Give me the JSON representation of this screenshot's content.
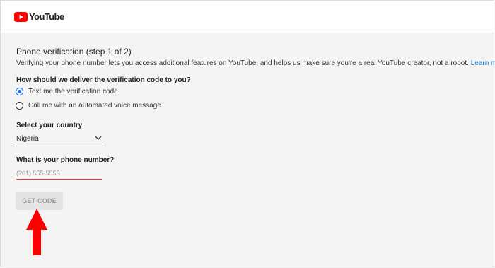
{
  "header": {
    "logo_text": "YouTube"
  },
  "verification": {
    "title": "Phone verification (step 1 of 2)",
    "description": "Verifying your phone number lets you access additional features on YouTube, and helps us make sure you're a real YouTube creator, not a robot.",
    "learn_more": "Learn more",
    "delivery_question": "How should we deliver the verification code to you?",
    "options": [
      {
        "label": "Text me the verification code",
        "selected": true
      },
      {
        "label": "Call me with an automated voice message",
        "selected": false
      }
    ],
    "country_label": "Select your country",
    "country_value": "Nigeria",
    "phone_label": "What is your phone number?",
    "phone_placeholder": "(201) 555-5555",
    "phone_value": "",
    "get_code_label": "GET CODE"
  },
  "colors": {
    "brand_red": "#ff0000",
    "accent_blue": "#1a73e8",
    "link_blue": "#1a73c8",
    "input_error_red": "#e53935",
    "annotation_red": "#ff0000"
  },
  "icons": {
    "logo": "youtube-play-icon",
    "select": "chevron-down-icon",
    "annotation": "red-arrow-up-icon"
  }
}
